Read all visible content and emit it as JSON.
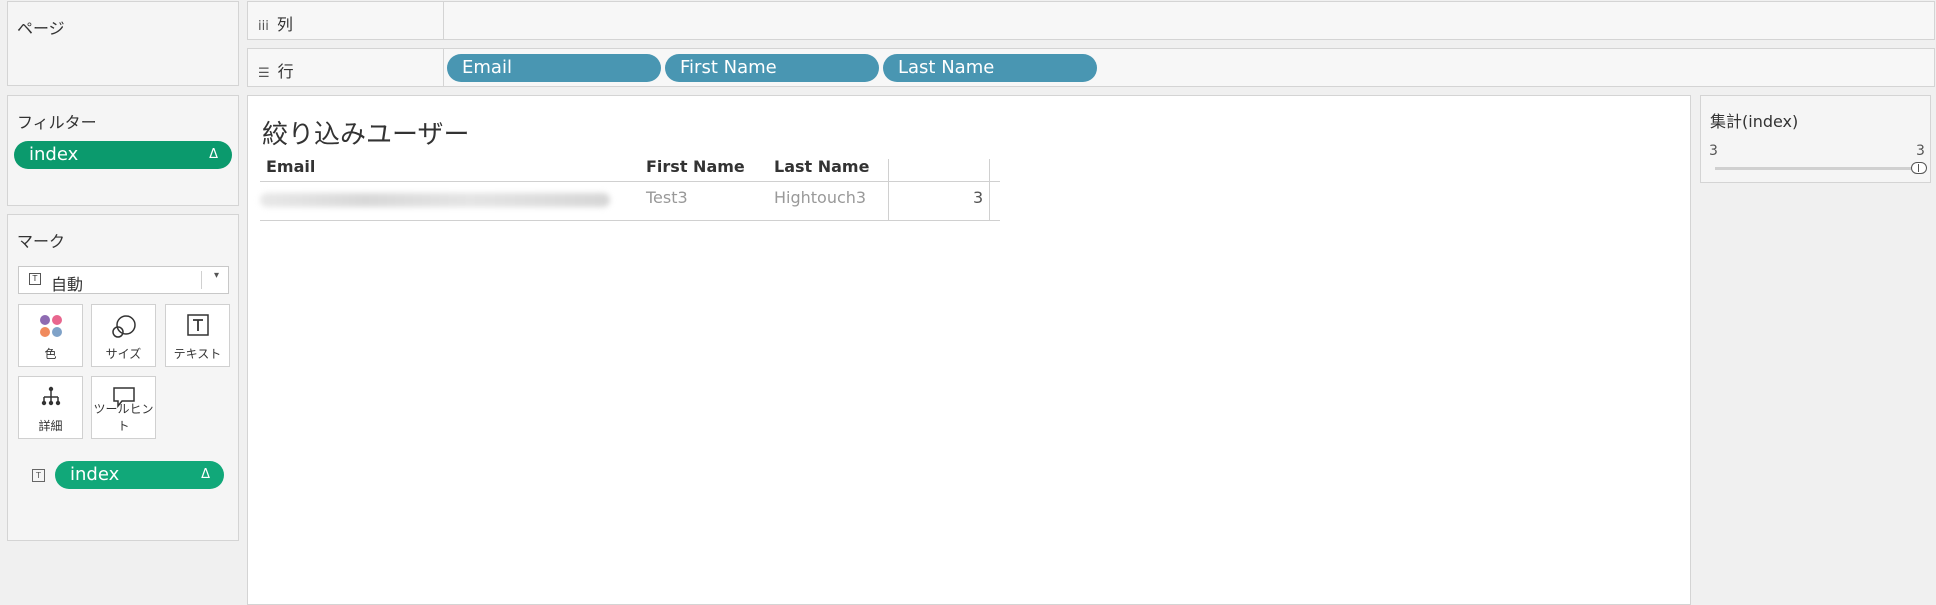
{
  "pages": {
    "title": "ページ"
  },
  "filters": {
    "title": "フィルター",
    "pill": {
      "label": "index",
      "delta": "Δ"
    }
  },
  "marks": {
    "title": "マーク",
    "mark_type": {
      "icon": "T",
      "label": "自動"
    },
    "buttons": [
      {
        "label": "色",
        "icon": "color-dots-icon"
      },
      {
        "label": "サイズ",
        "icon": "size-circles-icon"
      },
      {
        "label": "テキスト",
        "icon": "text-box-icon"
      },
      {
        "label": "詳細",
        "icon": "detail-tree-icon"
      },
      {
        "label": "ツールヒント",
        "icon": "tooltip-bubble-icon"
      }
    ],
    "field": {
      "icon": "T",
      "label": "index",
      "delta": "Δ"
    }
  },
  "shelves": {
    "columns": {
      "icon": "iii",
      "label": "列"
    },
    "rows": {
      "icon": "☰",
      "label": "行",
      "pills": [
        "Email",
        "First Name",
        "Last Name"
      ]
    }
  },
  "view": {
    "title": "絞り込みユーザー",
    "headers": [
      "Email",
      "First Name",
      "Last Name"
    ],
    "row": {
      "first_name": "Test3",
      "last_name": "Hightouch3",
      "value": "3"
    }
  },
  "legend": {
    "title": "集計(index)",
    "min": "3",
    "max": "3"
  },
  "colors": {
    "filter_pill": "#0b9a6d",
    "row_pill": "#4996b2",
    "marks_pill": "#11a879"
  }
}
